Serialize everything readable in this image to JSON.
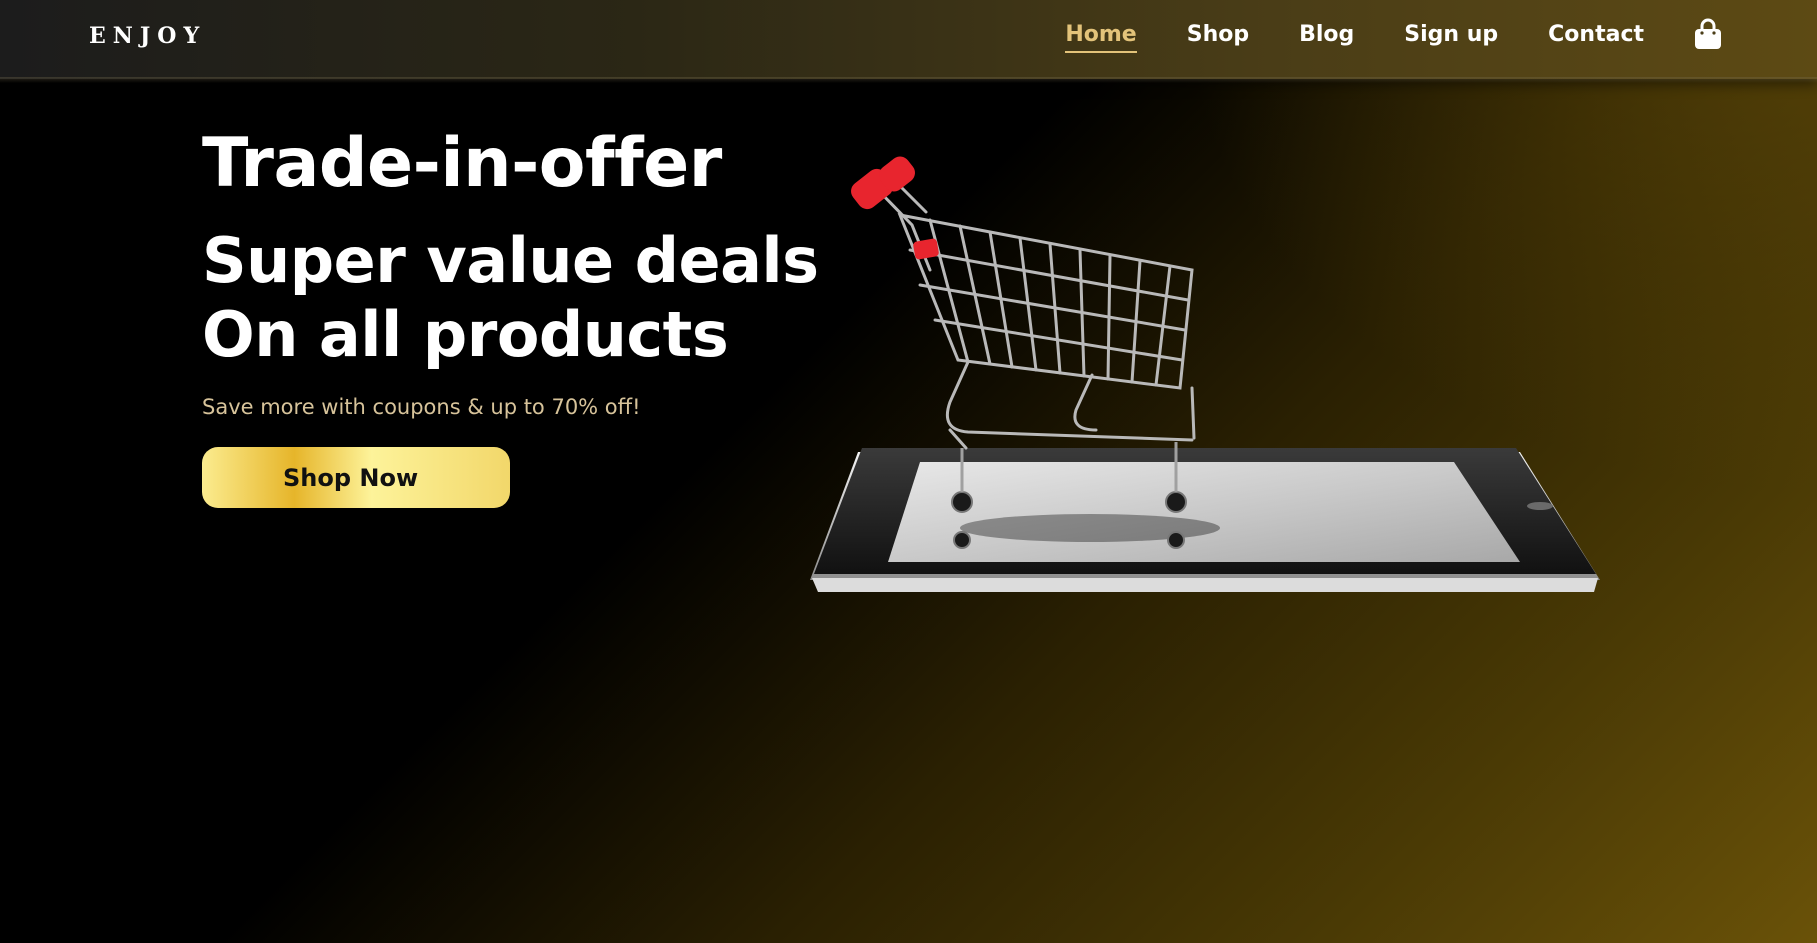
{
  "header": {
    "logo": "ENJOY",
    "nav": [
      {
        "label": "Home",
        "active": true
      },
      {
        "label": "Shop",
        "active": false
      },
      {
        "label": "Blog",
        "active": false
      },
      {
        "label": "Sign up",
        "active": false
      },
      {
        "label": "Contact",
        "active": false
      }
    ],
    "cart_icon": "shopping-bag-icon"
  },
  "hero": {
    "title_line1": "Trade-in-offer",
    "title_line2": "Super value deals",
    "title_line3": "On all products",
    "subtitle": "Save more with coupons & up to 70% off!",
    "cta_label": "Shop Now",
    "image": "shopping-cart-on-tablet"
  },
  "colors": {
    "accent_gold": "#e3c37a",
    "button_gold": "#f2d76a",
    "cart_red": "#e8252e"
  }
}
